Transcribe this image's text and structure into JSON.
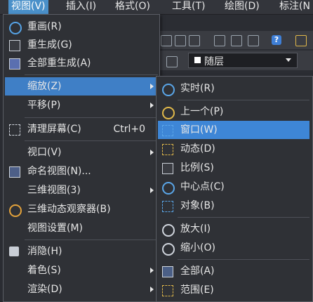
{
  "menubar": {
    "items": [
      "视图(V)",
      "插入(I)",
      "格式(O)",
      "工具(T)",
      "绘图(D)",
      "标注(N"
    ]
  },
  "layer": {
    "value": "随层"
  },
  "main_menu": {
    "items": [
      {
        "label": "重画(R)",
        "icon": "redraw-icon"
      },
      {
        "label": "重生成(G)",
        "icon": "regen-icon"
      },
      {
        "label": "全部重生成(A)",
        "icon": "regen-all-icon"
      },
      {
        "label": "缩放(Z)",
        "icon": "",
        "submenu": true
      },
      {
        "label": "平移(P)",
        "icon": "",
        "submenu": true
      },
      {
        "label": "清理屏幕(C)",
        "icon": "clean-screen-icon",
        "shortcut": "Ctrl+0"
      },
      {
        "label": "视口(V)",
        "icon": "",
        "submenu": true
      },
      {
        "label": "命名视图(N)...",
        "icon": "named-view-icon"
      },
      {
        "label": "三维视图(3)",
        "icon": "",
        "submenu": true
      },
      {
        "label": "三维动态观察器(B)",
        "icon": "orbit-icon"
      },
      {
        "label": "视图设置(M)",
        "icon": ""
      },
      {
        "label": "消隐(H)",
        "icon": "hide-icon"
      },
      {
        "label": "着色(S)",
        "icon": "",
        "submenu": true
      },
      {
        "label": "渲染(D)",
        "icon": "",
        "submenu": true
      }
    ]
  },
  "zoom_menu": {
    "items": [
      {
        "label": "实时(R)",
        "icon": "zoom-realtime-icon"
      },
      {
        "label": "上一个(P)",
        "icon": "zoom-previous-icon"
      },
      {
        "label": "窗口(W)",
        "icon": "zoom-window-icon"
      },
      {
        "label": "动态(D)",
        "icon": "zoom-dynamic-icon"
      },
      {
        "label": "比例(S)",
        "icon": "zoom-scale-icon"
      },
      {
        "label": "中心点(C)",
        "icon": "zoom-center-icon"
      },
      {
        "label": "对象(B)",
        "icon": "zoom-object-icon"
      },
      {
        "label": "放大(I)",
        "icon": "zoom-in-icon"
      },
      {
        "label": "缩小(O)",
        "icon": "zoom-out-icon"
      },
      {
        "label": "全部(A)",
        "icon": "zoom-all-icon"
      },
      {
        "label": "范围(E)",
        "icon": "zoom-extents-icon"
      }
    ]
  },
  "colors": {
    "menu_bg": "#2f3136",
    "highlight": "#3f7fc6",
    "menubar_active": "#4a90c9"
  }
}
